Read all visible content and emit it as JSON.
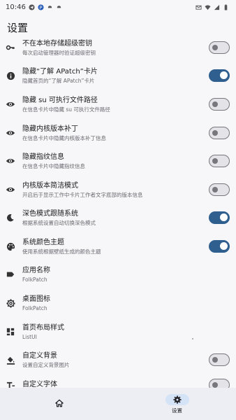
{
  "status_bar": {
    "time": "10:46"
  },
  "page_title": "设置",
  "rows": [
    {
      "title": "不在本地存储超级密钥",
      "sub": "每次启动管理器时验证超级密钥",
      "switch": false,
      "icon": "key-icon"
    },
    {
      "title": "隐藏“了解 APatch”卡片",
      "sub": "隐藏首页的“了解 APatch”卡片",
      "switch": true,
      "icon": "info-icon"
    },
    {
      "title": "隐藏 su 可执行文件路径",
      "sub": "在信息卡片中隐藏 su 可执行文件路径",
      "switch": false,
      "icon": "eye-icon"
    },
    {
      "title": "隐藏内核版本补丁",
      "sub": "在信息卡片中隐藏内核版本补丁信息",
      "switch": false,
      "icon": "eye-icon"
    },
    {
      "title": "隐藏指纹信息",
      "sub": "在信息卡片中隐藏指纹信息",
      "switch": false,
      "icon": "eye-icon"
    },
    {
      "title": "内核版本简洁模式",
      "sub": "开启后于显示工作中卡片工作者文字底部的版本信息",
      "switch": false,
      "icon": "eye-icon"
    },
    {
      "title": "深色模式跟随系统",
      "sub": "根据系统设置自动切换深色模式",
      "switch": true,
      "icon": "moon-icon"
    },
    {
      "title": "系统颜色主题",
      "sub": "使用系统根据壁纸生成的颜色主题",
      "switch": true,
      "icon": "palette-icon"
    },
    {
      "title": "应用名称",
      "sub": "FolkPatch",
      "switch": null,
      "icon": "label-icon"
    },
    {
      "title": "桌面图标",
      "sub": "FolkPatch",
      "switch": null,
      "icon": "gear-icon"
    },
    {
      "title": "首页布局样式",
      "sub": "ListUI",
      "switch": null,
      "icon": "dashboard-icon"
    },
    {
      "title": "自定义背景",
      "sub": "设置自定义背景图片",
      "switch": false,
      "icon": "format-color-fill-icon"
    },
    {
      "title": "自定义字体",
      "sub": "",
      "switch": false,
      "icon": "text-format-icon"
    }
  ],
  "bottom_nav": {
    "home_label": "",
    "settings_label": "设置"
  },
  "colors": {
    "accent": "#2f5f8f",
    "nav_bg": "#eceef4",
    "nav_pill": "#d5e3f7"
  }
}
